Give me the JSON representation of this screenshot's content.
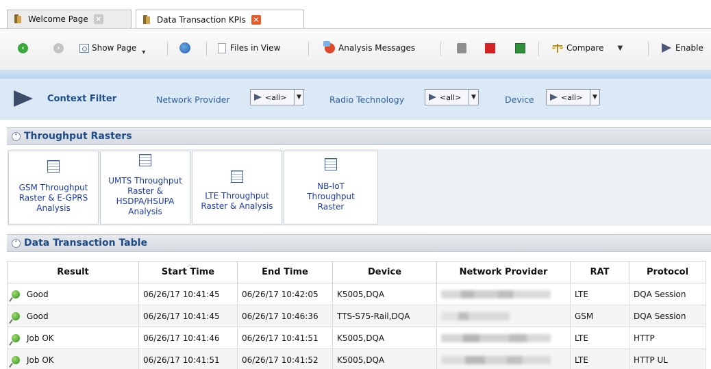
{
  "tabs": [
    {
      "label": "Welcome Page",
      "active": false,
      "close_icon": "close-icon-grey"
    },
    {
      "label": "Data Transaction KPIs",
      "active": true,
      "close_icon": "close-icon-red"
    }
  ],
  "toolbar": {
    "show_page": "Show Page",
    "files_in_view": "Files in View",
    "analysis_messages": "Analysis Messages",
    "compare": "Compare",
    "enable": "Enable"
  },
  "context_filter": {
    "title": "Context Filter",
    "filters": [
      {
        "label": "Network Provider",
        "value": "<all>"
      },
      {
        "label": "Radio Technology",
        "value": "<all>"
      },
      {
        "label": "Device",
        "value": "<all>"
      }
    ]
  },
  "throughput_rasters": {
    "title": "Throughput Rasters",
    "tiles": [
      {
        "lines": [
          "GSM Throughput",
          "Raster & E-GPRS",
          "Analysis"
        ]
      },
      {
        "lines": [
          "UMTS Throughput",
          "Raster &",
          "HSDPA/HSUPA",
          "Analysis"
        ]
      },
      {
        "lines": [
          "LTE Throughput",
          "Raster & Analysis"
        ]
      },
      {
        "lines": [
          "NB-IoT",
          "Throughput",
          "Raster"
        ]
      }
    ]
  },
  "data_table": {
    "title": "Data Transaction Table",
    "columns": [
      "Result",
      "Start Time",
      "End Time",
      "Device",
      "Network Provider",
      "RAT",
      "Protocol"
    ],
    "rows": [
      {
        "result": "Good",
        "start": "06/26/17 10:41:45",
        "end": "06/26/17 10:42:05",
        "device": "K5005,DQA",
        "rat": "LTE",
        "protocol": "DQA Session"
      },
      {
        "result": "Good",
        "start": "06/26/17 10:41:45",
        "end": "06/26/17 10:46:36",
        "device": "TTS-S75-Rail,DQA",
        "rat": "GSM",
        "protocol": "DQA Session"
      },
      {
        "result": "Job OK",
        "start": "06/26/17 10:41:46",
        "end": "06/26/17 10:41:51",
        "device": "K5005,DQA",
        "rat": "LTE",
        "protocol": "HTTP"
      },
      {
        "result": "Job OK",
        "start": "06/26/17 10:41:51",
        "end": "06/26/17 10:41:52",
        "device": "K5005,DQA",
        "rat": "LTE",
        "protocol": "HTTP UL"
      }
    ]
  },
  "colors": {
    "accent_blue": "#1d4c8a",
    "link_blue": "#1c3aa8",
    "context_bg": "#dbe8f5",
    "result_icon": "#2c8a1e"
  }
}
